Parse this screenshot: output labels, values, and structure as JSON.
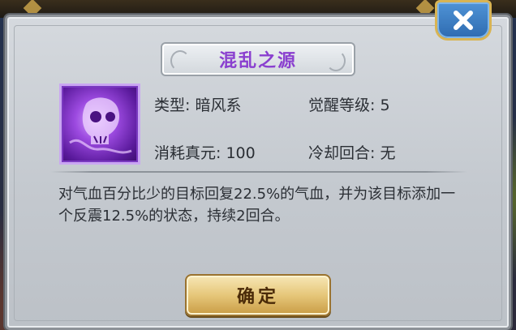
{
  "skill": {
    "name": "混乱之源",
    "type_label": "类型: 暗风系",
    "awaken_label": "觉醒等级: 5",
    "cost_label": "消耗真元: 100",
    "cooldown_label": "冷却回合: 无",
    "description": "对气血百分比少的目标回复22.5%的气血，并为该目标添加一个反震12.5%的状态，持续2回合。"
  },
  "buttons": {
    "confirm": "确定",
    "close_icon": "close-icon"
  },
  "colors": {
    "title": "#8a3fcf",
    "panel": "#c9ced3",
    "confirm": "#e6c77a",
    "close": "#3a7cc2"
  }
}
